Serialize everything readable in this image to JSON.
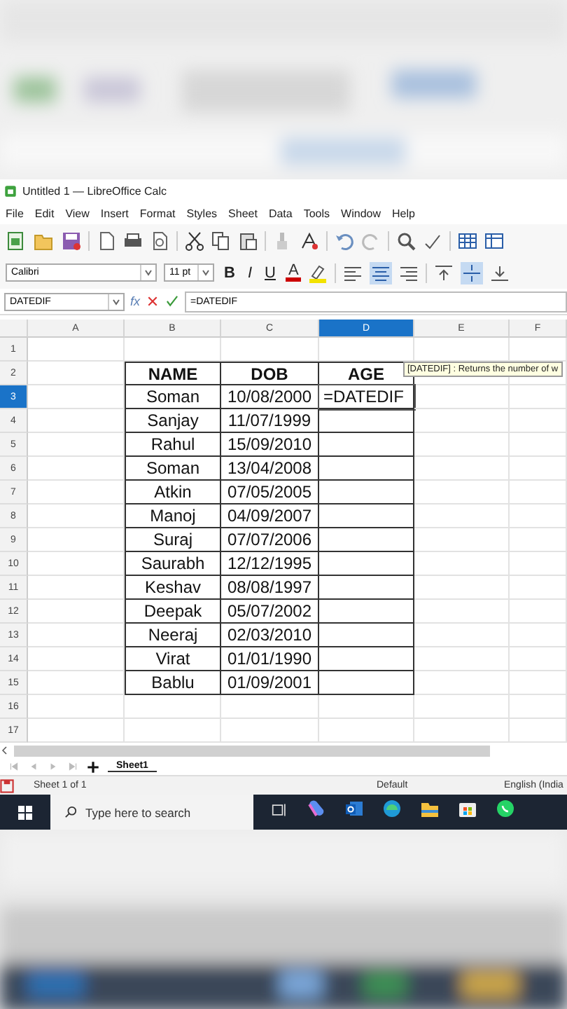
{
  "window": {
    "title": "Untitled 1 — LibreOffice Calc"
  },
  "menu": [
    "File",
    "Edit",
    "View",
    "Insert",
    "Format",
    "Styles",
    "Sheet",
    "Data",
    "Tools",
    "Window",
    "Help"
  ],
  "format_bar": {
    "font": "Calibri",
    "size": "11 pt",
    "bold": "B",
    "italic": "I",
    "underline": "U",
    "font_color": "A"
  },
  "formula_bar": {
    "name_box": "DATEDIF",
    "function_wizard": "fx",
    "formula": "=DATEDIF"
  },
  "columns": [
    {
      "label": "A",
      "selected": false
    },
    {
      "label": "B",
      "selected": false
    },
    {
      "label": "C",
      "selected": false
    },
    {
      "label": "D",
      "selected": true
    },
    {
      "label": "E",
      "selected": false
    },
    {
      "label": "F",
      "selected": false
    }
  ],
  "row_numbers": [
    {
      "label": "1",
      "selected": false
    },
    {
      "label": "2",
      "selected": false
    },
    {
      "label": "3",
      "selected": true
    },
    {
      "label": "4",
      "selected": false
    },
    {
      "label": "5",
      "selected": false
    },
    {
      "label": "6",
      "selected": false
    },
    {
      "label": "7",
      "selected": false
    },
    {
      "label": "8",
      "selected": false
    },
    {
      "label": "9",
      "selected": false
    },
    {
      "label": "10",
      "selected": false
    },
    {
      "label": "11",
      "selected": false
    },
    {
      "label": "12",
      "selected": false
    },
    {
      "label": "13",
      "selected": false
    },
    {
      "label": "14",
      "selected": false
    },
    {
      "label": "15",
      "selected": false
    },
    {
      "label": "16",
      "selected": false
    },
    {
      "label": "17",
      "selected": false
    }
  ],
  "table": {
    "headers": [
      "NAME",
      "DOB",
      "AGE"
    ],
    "rows": [
      {
        "name": "Soman",
        "dob": "10/08/2000",
        "age": "=DATEDIF"
      },
      {
        "name": "Sanjay",
        "dob": "11/07/1999"
      },
      {
        "name": "Rahul",
        "dob": "15/09/2010"
      },
      {
        "name": "Soman",
        "dob": "13/04/2008"
      },
      {
        "name": "Atkin",
        "dob": "07/05/2005"
      },
      {
        "name": "Manoj",
        "dob": "04/09/2007"
      },
      {
        "name": "Suraj",
        "dob": "07/07/2006"
      },
      {
        "name": "Saurabh",
        "dob": "12/12/1995"
      },
      {
        "name": "Keshav",
        "dob": "08/08/1997"
      },
      {
        "name": "Deepak",
        "dob": "05/07/2002"
      },
      {
        "name": "Neeraj",
        "dob": "02/03/2010"
      },
      {
        "name": "Virat",
        "dob": "01/01/1990"
      },
      {
        "name": "Bablu",
        "dob": "01/09/2001"
      }
    ]
  },
  "tooltip": "[DATEDIF] : Returns the number of w",
  "sheet_tabs": [
    {
      "label": "Sheet1",
      "selected": true
    }
  ],
  "status_bar": {
    "sheet": "Sheet 1 of 1",
    "style": "Default",
    "language": "English (India"
  },
  "taskbar": {
    "search": {
      "placeholder": "Type here to search"
    }
  }
}
